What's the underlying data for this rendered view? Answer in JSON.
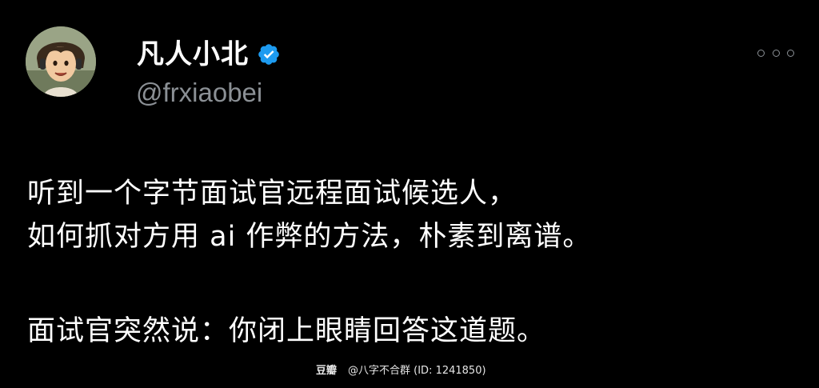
{
  "post": {
    "author": {
      "display_name": "凡人小北",
      "handle": "@frxiaobei",
      "verified": true,
      "verified_color": "#1d9bf0"
    },
    "body": {
      "lines": [
        "听到一个字节面试官远程面试候选人，",
        "如何抓对方用 ai 作弊的方法，朴素到离谱。",
        "面试官突然说：你闭上眼睛回答这道题。"
      ]
    },
    "menu_icon": "more-horizontal-icon"
  },
  "watermark": {
    "brand": "豆瓣",
    "text": "@八字不合群 (ID: 1241850)"
  },
  "colors": {
    "background": "#000000",
    "text": "#ffffff",
    "secondary": "#8b9095",
    "accent": "#1d9bf0"
  }
}
